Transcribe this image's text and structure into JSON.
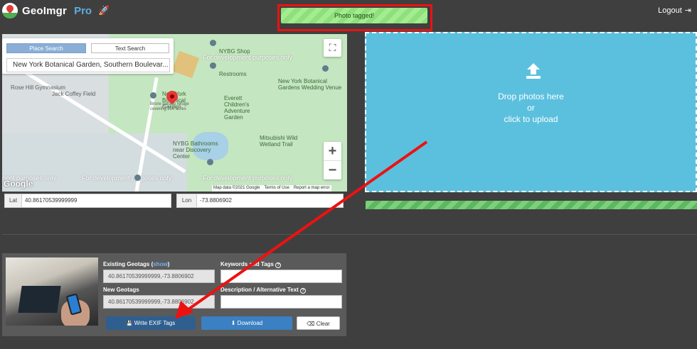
{
  "header": {
    "logo_text": "GeoImgr",
    "logo_pro": "Pro",
    "rocket_glyph": "🚀",
    "logout_label": "Logout",
    "logout_glyph": "⇥"
  },
  "toast": {
    "message": "Photo tagged!"
  },
  "map": {
    "search_tabs": {
      "place": "Place Search",
      "text": "Text Search"
    },
    "place_value": "New York Botanical Garden, Southern Boulevar...",
    "labels": {
      "dev1": "For development purposes only",
      "dev2": "nent purposes only",
      "dev3": "For development purposes only",
      "dev4": "For development purposes only",
      "nybg_shop": "NYBG Shop",
      "restrooms": "Restrooms",
      "rose_hill": "Rose Hill Gymnasium",
      "jack_coffey": "Jack Coffey Field",
      "nybg_name": "New York Botanical Garden",
      "nybg_sub": "Bronx garden refuge covering 250 acres",
      "wedding": "New York Botanical Gardens Wedding Venue",
      "everett": "Everett Children's Adventure Garden",
      "mitsubishi": "Mitsubishi Wild Wetland Trail",
      "bathrooms": "NYBG Bathrooms near Discovery Center"
    },
    "google_logo": "Google",
    "attribution": [
      "Map data ©2021 Google",
      "Terms of Use",
      "Report a map error"
    ],
    "fullscreen_glyph": "⛶",
    "zoom_in": "+",
    "zoom_out": "−"
  },
  "coords": {
    "lat_label": "Lat",
    "lat_value": "40.86170539999999",
    "lon_label": "Lon",
    "lon_value": "-73.8806902"
  },
  "dropzone": {
    "line1": "Drop photos here",
    "line2": "or",
    "line3": "click to upload",
    "icon": "upload-icon",
    "progress": 1
  },
  "photo": {
    "existing_label": "Existing Geotags (",
    "show_link": "show",
    "existing_suffix": ")",
    "existing_value": "40.86170539999999,-73.8806902",
    "new_label": "New Geotags",
    "new_value": "40.86170539999999,-73.8806902",
    "keywords_label": "Keywords and Tags",
    "description_label": "Description / Alternative Text",
    "info_glyph": "?"
  },
  "buttons": {
    "write_label": "Write EXIF Tags",
    "write_glyph": "💾",
    "download_label": "Download",
    "download_glyph": "⬇",
    "clear_label": "Clear",
    "clear_glyph": "⌫"
  },
  "colors": {
    "annotation": "#ee1111",
    "dropzone": "#5bc0de",
    "toast": "#8ee07a"
  }
}
